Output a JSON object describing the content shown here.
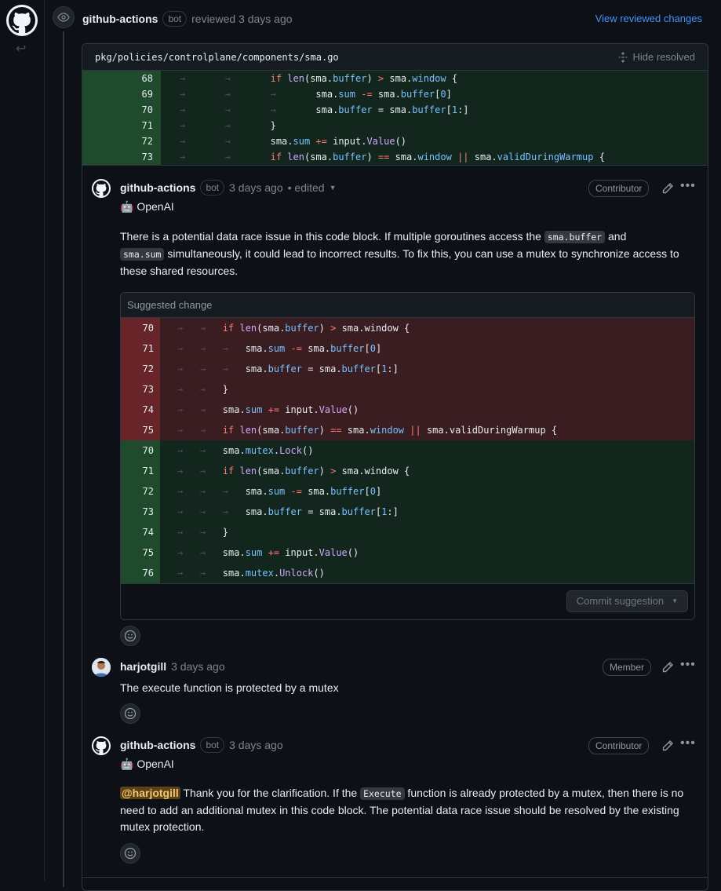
{
  "review": {
    "author": "github-actions",
    "bot_label": "bot",
    "action": "reviewed 3 days ago",
    "view_changes": "View reviewed changes"
  },
  "file": {
    "path": "pkg/policies/controlplane/components/sma.go",
    "hide_resolved": "Hide resolved"
  },
  "diff_lines": [
    {
      "num": "68"
    },
    {
      "num": "69"
    },
    {
      "num": "70"
    },
    {
      "num": "71"
    },
    {
      "num": "72"
    },
    {
      "num": "73"
    }
  ],
  "comment1": {
    "author": "github-actions",
    "bot_label": "bot",
    "time": "3 days ago",
    "edited": "• edited",
    "role": "Contributor",
    "sender": "🤖 OpenAI",
    "text_a": "There is a potential data race issue in this code block. If multiple goroutines access the ",
    "code_a": "sma.buffer",
    "text_b": " and",
    "code_b": "sma.sum",
    "text_c": " simultaneously, it could lead to incorrect results. To fix this, you can use a mutex to synchronize access to these shared resources.",
    "suggest_title": "Suggested change",
    "commit_label": "Commit suggestion"
  },
  "suggest_del_nums": [
    "70",
    "71",
    "72",
    "73",
    "74",
    "75"
  ],
  "suggest_add_nums": [
    "70",
    "71",
    "72",
    "73",
    "74",
    "75",
    "76"
  ],
  "comment2": {
    "author": "harjotgill",
    "time": "3 days ago",
    "role": "Member",
    "text": "The execute function is protected by a mutex"
  },
  "comment3": {
    "author": "github-actions",
    "bot_label": "bot",
    "time": "3 days ago",
    "role": "Contributor",
    "sender": "🤖 OpenAI",
    "mention": "@harjotgill",
    "text_a": " Thank you for the clarification. If the ",
    "code": "Execute",
    "text_b": " function is already protected by a mutex, then there is no need to add an additional mutex in this code block. The potential data race issue should be resolved by the existing mutex protection."
  },
  "icons": [
    "github-logo-icon",
    "eye-icon",
    "reply-icon",
    "pencil-icon",
    "kebab-icon",
    "smiley-icon",
    "unfold-icon",
    "caret-down-icon"
  ]
}
